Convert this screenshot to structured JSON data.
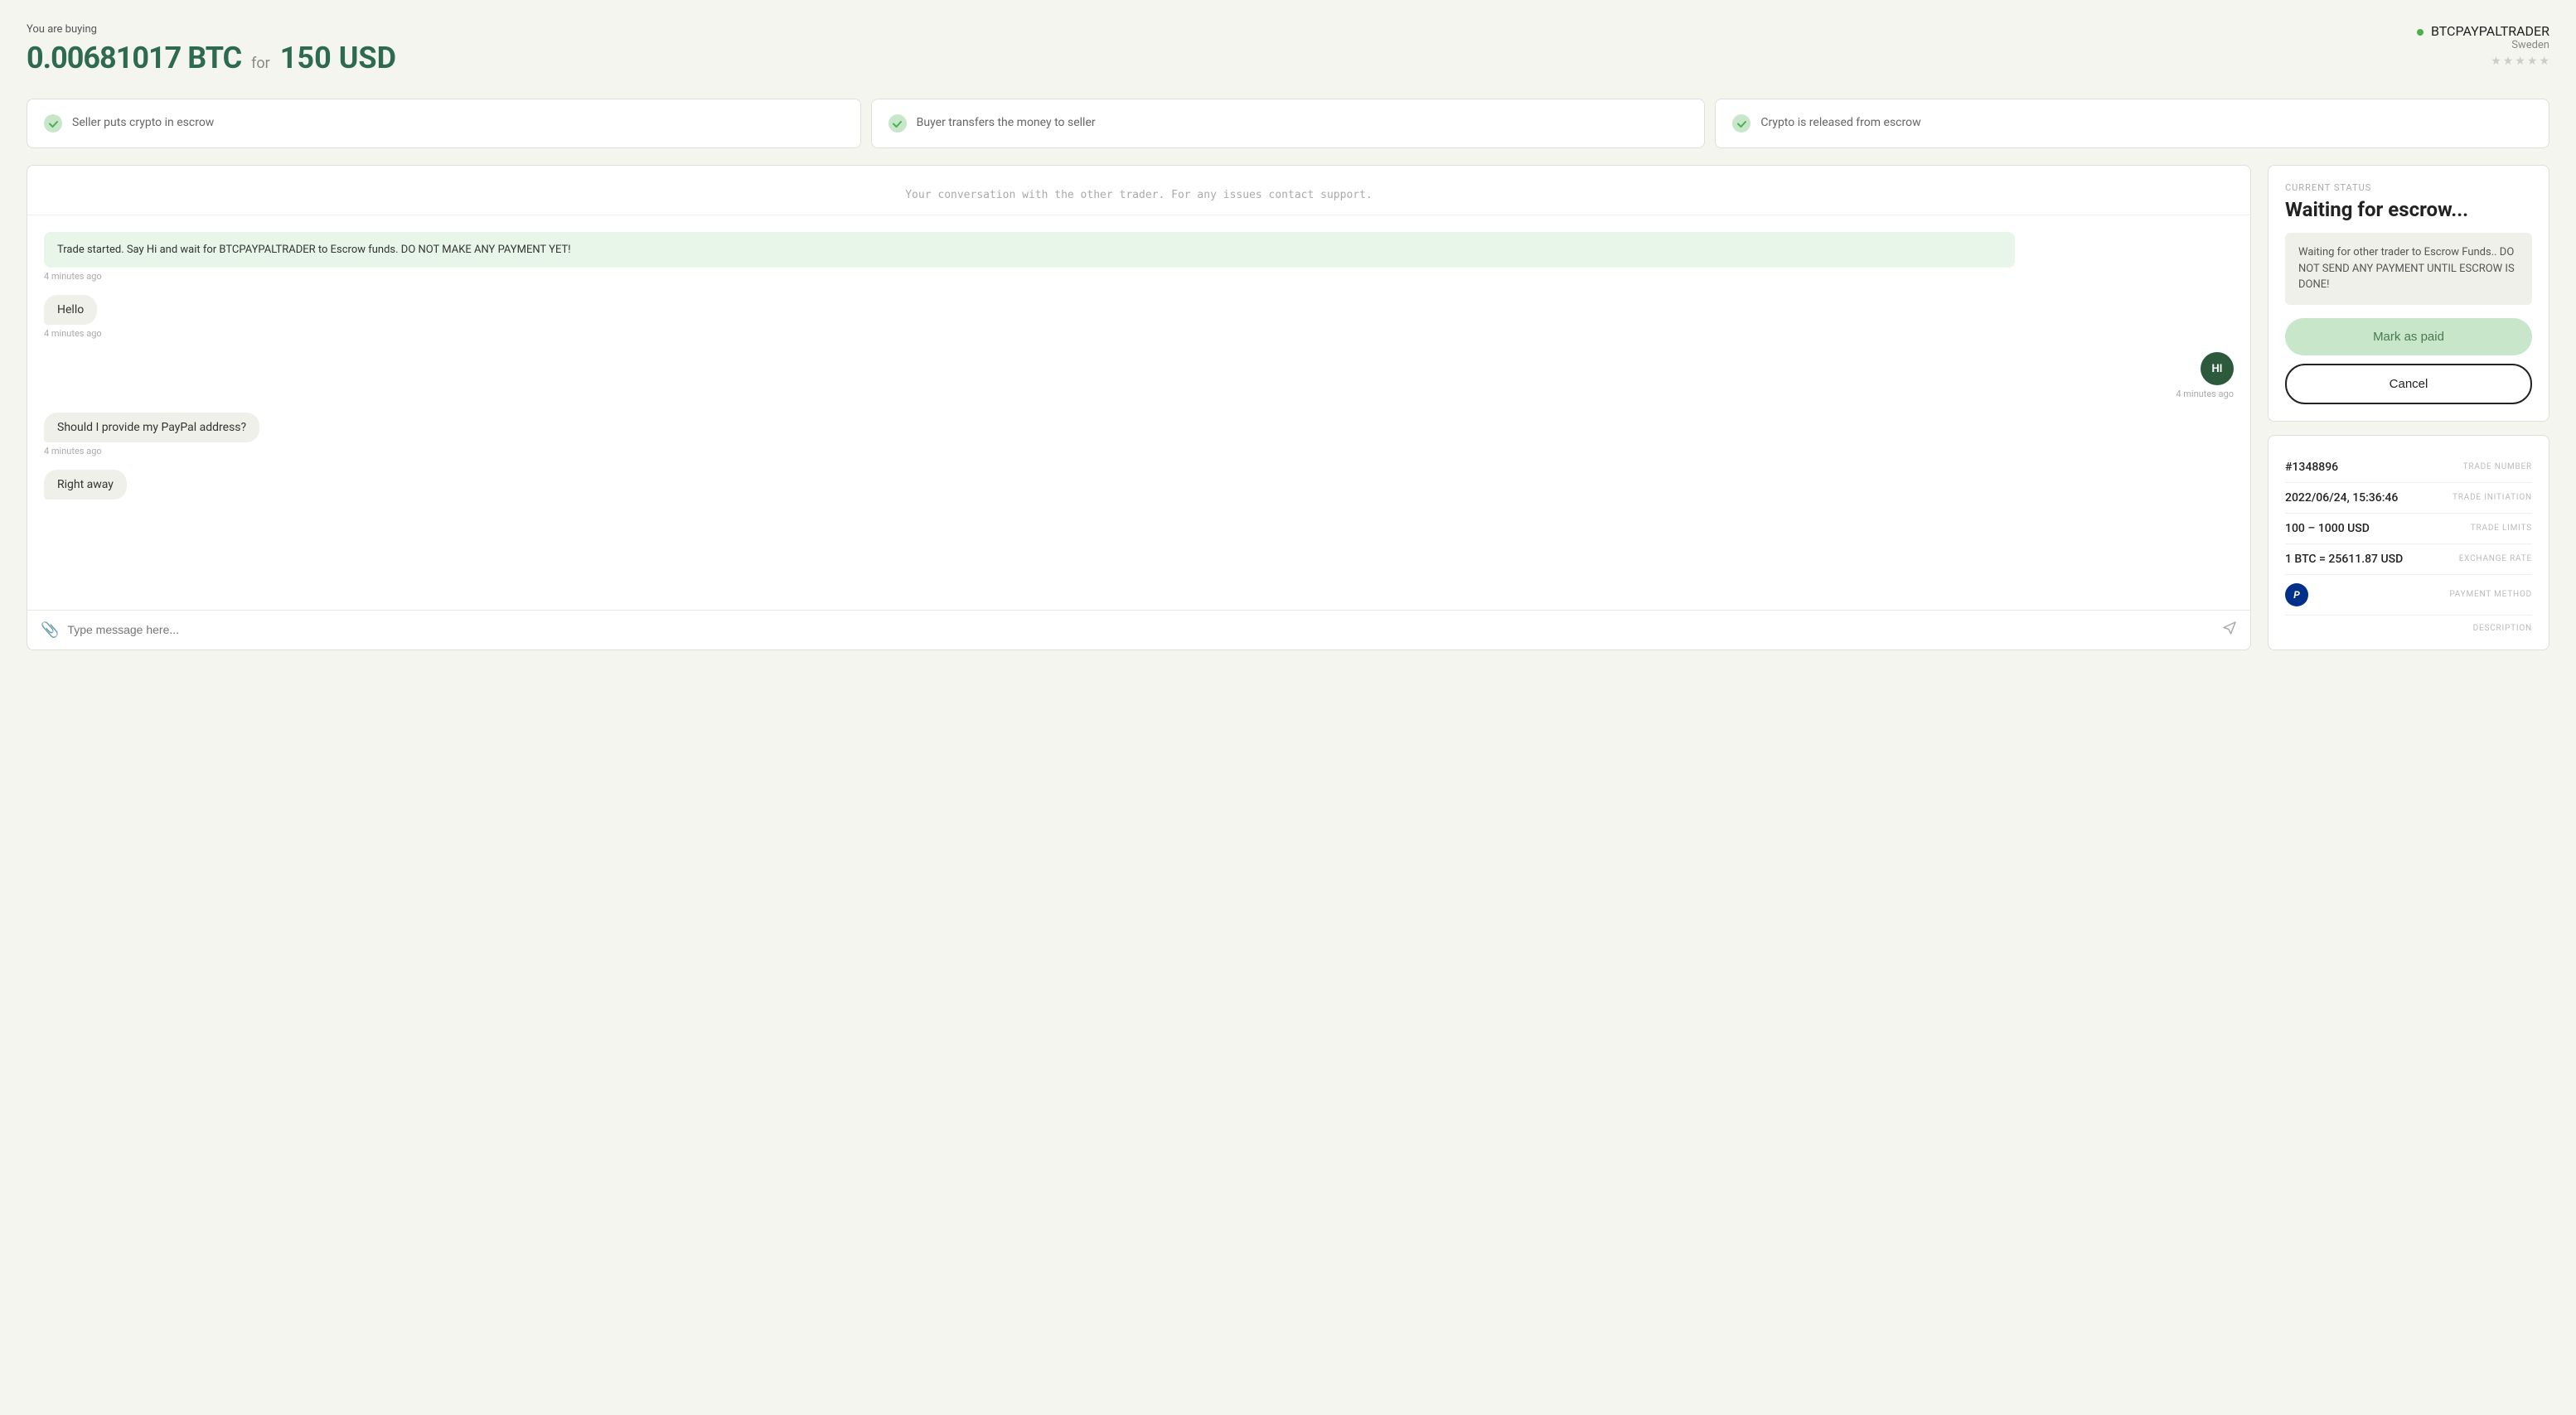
{
  "header": {
    "buying_label": "You are buying",
    "btc_amount": "0.00681017 BTC",
    "for_label": "for",
    "usd_amount": "150 USD",
    "trader": {
      "name": "BTCPAYPALTRADER",
      "country": "Sweden",
      "stars": [
        "★",
        "★",
        "★",
        "★",
        "★"
      ]
    }
  },
  "steps": [
    {
      "id": "step1",
      "text": "Seller puts crypto in escrow"
    },
    {
      "id": "step2",
      "text": "Buyer transfers the money to seller"
    },
    {
      "id": "step3",
      "text": "Crypto is released from escrow"
    }
  ],
  "chat": {
    "notice": "Your conversation with the other trader. For any issues contact support.",
    "messages": [
      {
        "id": "msg1",
        "type": "system",
        "text": "Trade started. Say Hi and wait for BTCPAYPALTRADER to Escrow funds. DO NOT MAKE ANY PAYMENT YET!",
        "time": "4 minutes ago"
      },
      {
        "id": "msg2",
        "type": "left",
        "text": "Hello",
        "time": "4 minutes ago"
      },
      {
        "id": "msg3",
        "type": "right",
        "avatar": "HI",
        "time": "4 minutes ago"
      },
      {
        "id": "msg4",
        "type": "left",
        "text": "Should I provide my PayPal address?",
        "time": "4 minutes ago"
      },
      {
        "id": "msg5",
        "type": "left",
        "text": "Right away",
        "time": ""
      }
    ],
    "input_placeholder": "Type message here..."
  },
  "status": {
    "current_status_label": "CURRENT STATUS",
    "title": "Waiting for escrow...",
    "notice": "Waiting for other trader to Escrow Funds.. DO NOT SEND ANY PAYMENT UNTIL ESCROW IS DONE!",
    "mark_paid_label": "Mark as paid",
    "cancel_label": "Cancel"
  },
  "trade_details": {
    "trade_number_value": "#1348896",
    "trade_number_label": "TRADE NUMBER",
    "trade_initiation_value": "2022/06/24, 15:36:46",
    "trade_initiation_label": "TRADE INITIATION",
    "trade_limits_value": "100 – 1000 USD",
    "trade_limits_label": "TRADE LIMITS",
    "exchange_rate_value": "1 BTC = 25611.87 USD",
    "exchange_rate_label": "EXCHANGE RATE",
    "payment_method_label": "PAYMENT METHOD",
    "payment_icon": "P",
    "description_label": "DESCRIPTION"
  }
}
